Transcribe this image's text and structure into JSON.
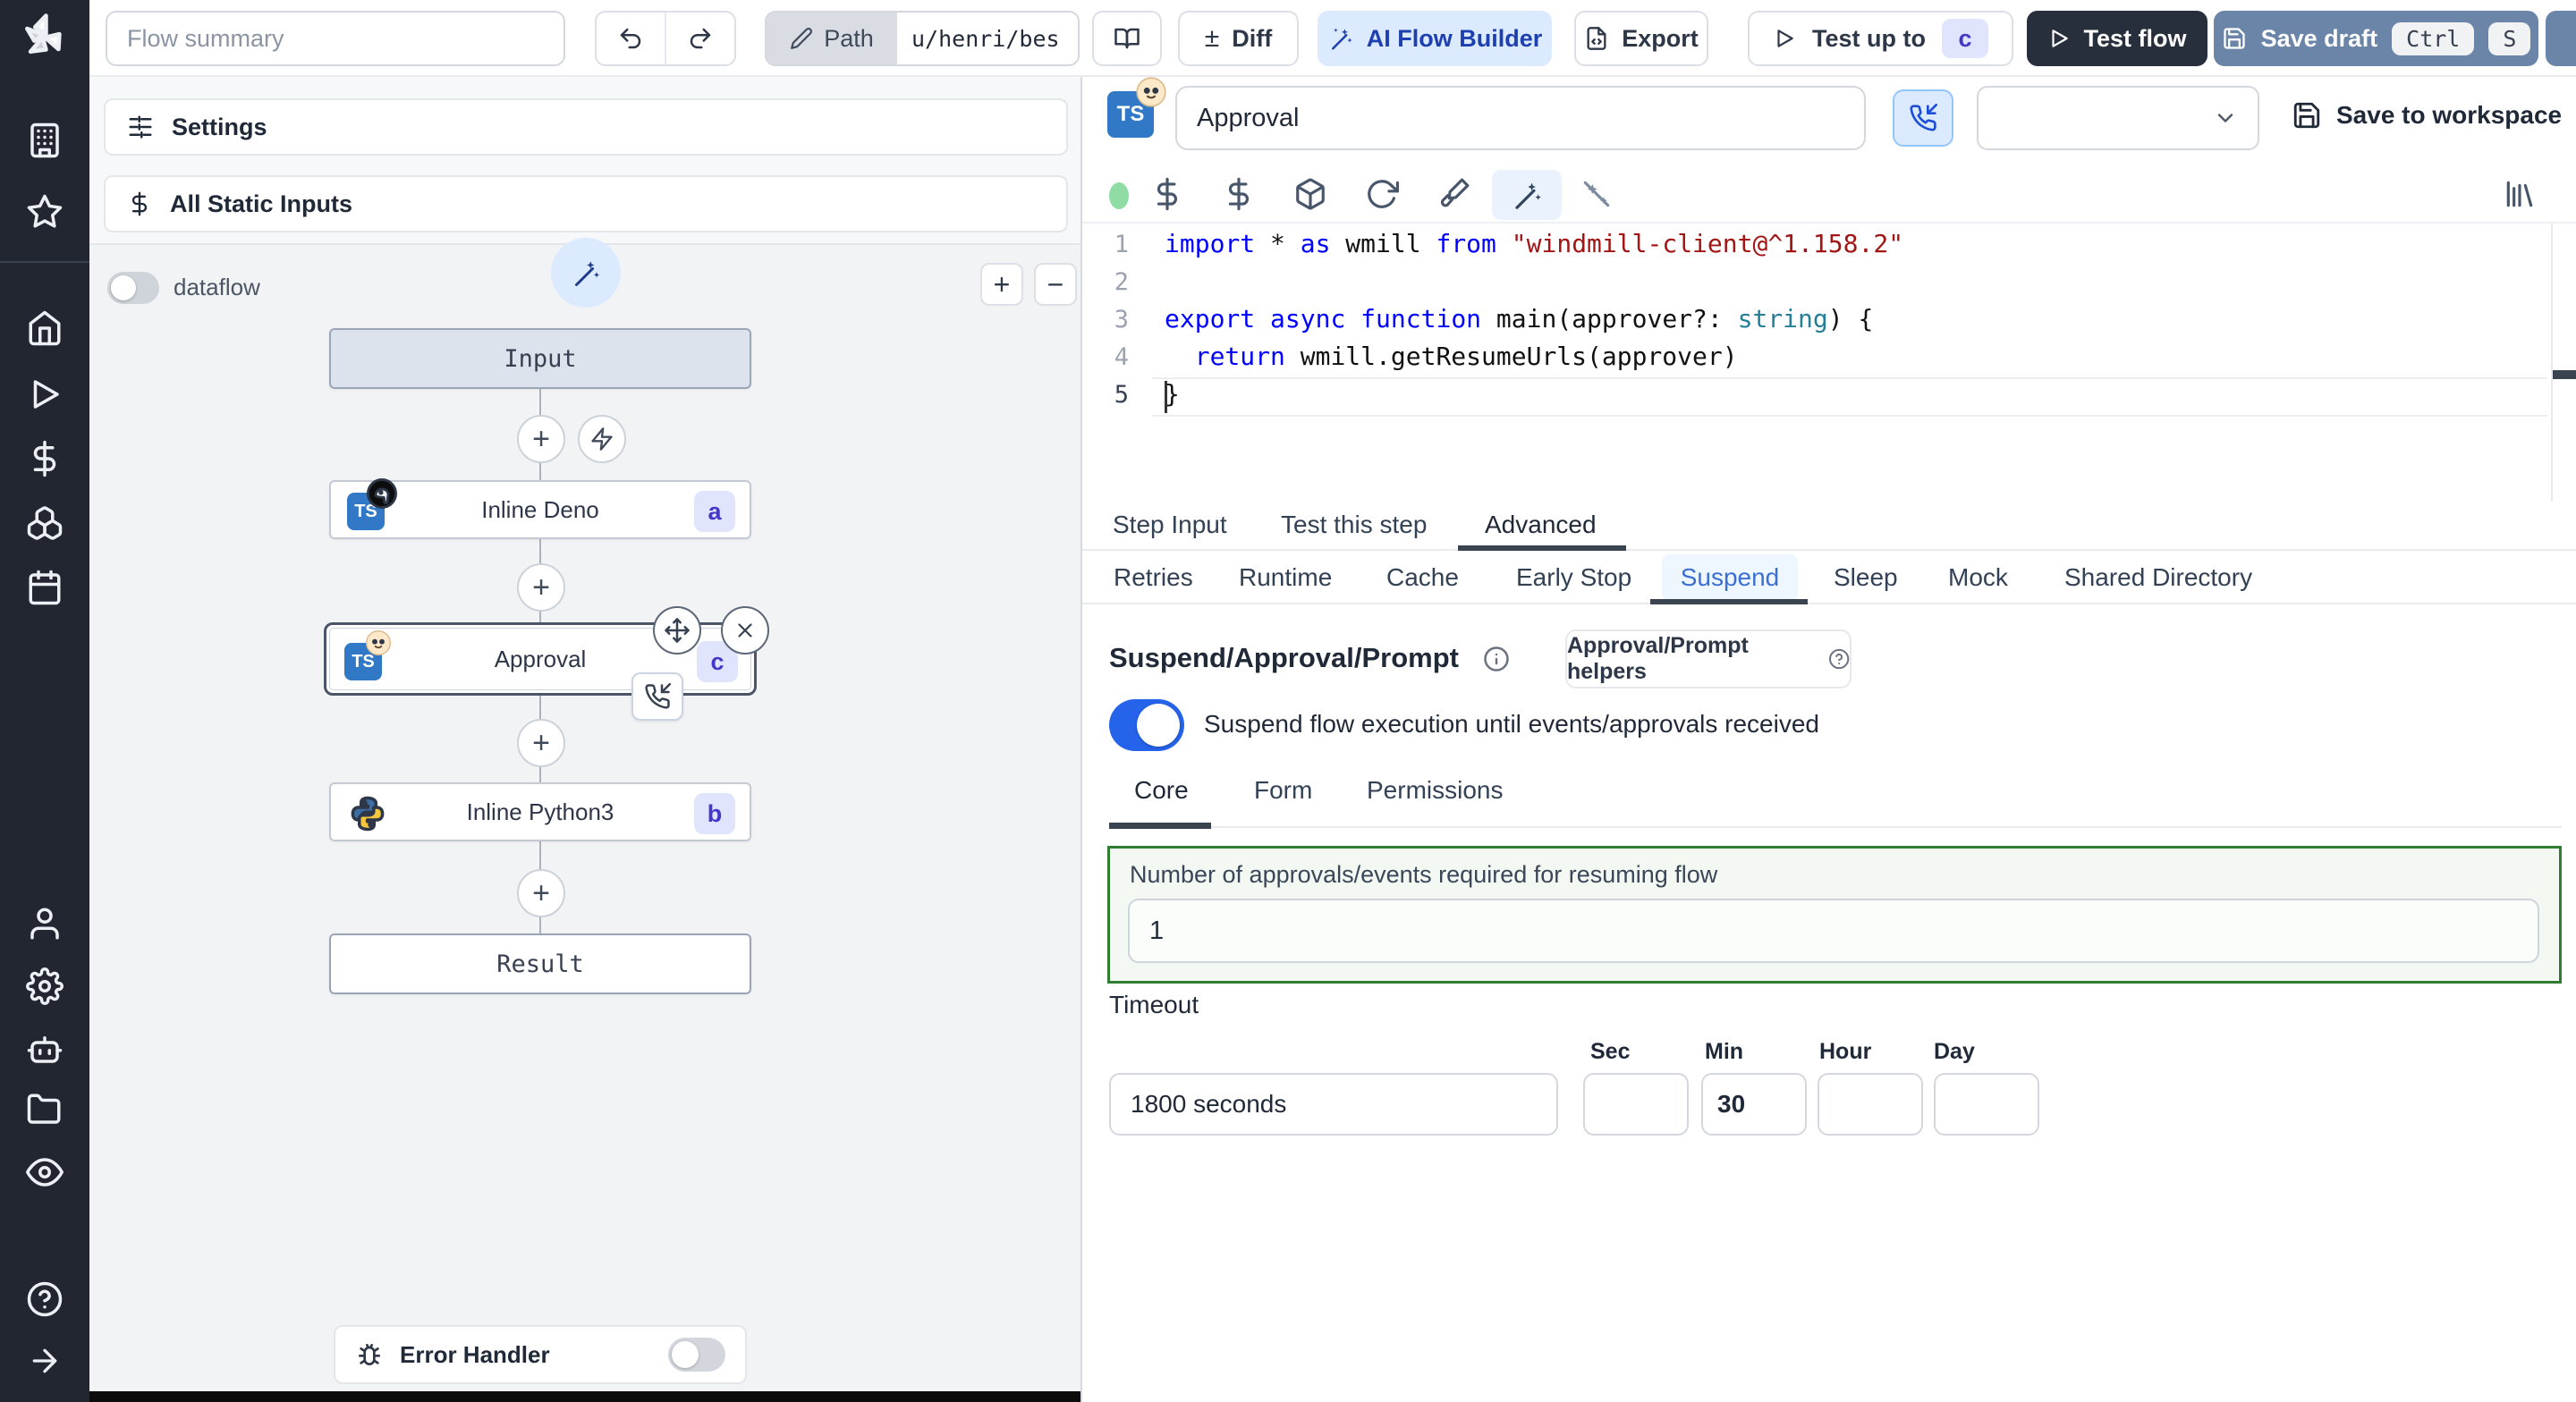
{
  "colors": {
    "sidebar_bg": "#212631",
    "accent_blue": "#2563eb",
    "ai_button_bg": "#dbeafe",
    "ai_button_text": "#1e40af",
    "test_flow_bg": "#262f3b",
    "save_draft_bg": "#6b85a8",
    "badge_bg": "#e0e4fc",
    "badge_text": "#4338ca",
    "ts_badge_bg": "#3178c6",
    "suspend_box_border": "#2e7d32",
    "code_keyword": "#0000ff",
    "code_string": "#a31515",
    "code_type": "#267f99"
  },
  "sidebar": {
    "icons": [
      "windmill-logo",
      "building",
      "star",
      "home",
      "play",
      "dollar",
      "resources",
      "calendar",
      "user",
      "settings",
      "worker",
      "folder",
      "eye",
      "help",
      "expand"
    ]
  },
  "topbar": {
    "flow_summary_placeholder": "Flow summary",
    "path_label": "Path",
    "path_value": "u/henri/bes",
    "diff_label": "Diff",
    "diff_sign": "±",
    "ai_builder_label": "AI Flow Builder",
    "export_label": "Export",
    "test_up_to_label": "Test up to",
    "test_up_to_badge": "c",
    "test_flow_label": "Test flow",
    "save_draft_label": "Save draft",
    "kbd_ctrl": "Ctrl",
    "kbd_s": "S"
  },
  "flow_panel": {
    "settings_label": "Settings",
    "all_static_inputs_label": "All Static Inputs",
    "dataflow_label": "dataflow",
    "zoom_in_label": "+",
    "zoom_out_label": "−",
    "nodes": {
      "input_label": "Input",
      "deno_lang": "TS",
      "deno_label": "Inline Deno",
      "deno_badge": "a",
      "approval_lang": "TS",
      "approval_label": "Approval",
      "approval_badge": "c",
      "python_label": "Inline Python3",
      "python_badge": "b",
      "result_label": "Result"
    },
    "error_handler_label": "Error Handler"
  },
  "step_panel": {
    "lang_badge": "TS",
    "name_value": "Approval",
    "save_to_workspace_label": "Save to workspace",
    "code": {
      "line_numbers": [
        "1",
        "2",
        "3",
        "4",
        "5"
      ],
      "l1": {
        "kw1": "import",
        "p1": " * ",
        "kw2": "as",
        "p2": " wmill ",
        "kw3": "from",
        "str": " \"windmill-client@^1.158.2\""
      },
      "l3": {
        "kw1": "export",
        "p1": " ",
        "kw2": "async",
        "p2": " ",
        "kw3": "function",
        "p3": " main(approver?: ",
        "type": "string",
        "p4": ") {"
      },
      "l4": {
        "ind": "  ",
        "kw1": "return",
        "p1": " wmill.getResumeUrls(approver)"
      },
      "l5": {
        "p1": "}"
      }
    },
    "tabs": {
      "step_input": "Step Input",
      "test_this_step": "Test this step",
      "advanced": "Advanced"
    },
    "advanced_tabs": {
      "retries": "Retries",
      "runtime": "Runtime",
      "cache": "Cache",
      "early_stop": "Early Stop",
      "suspend": "Suspend",
      "sleep": "Sleep",
      "mock": "Mock",
      "shared_directory": "Shared Directory"
    },
    "suspend": {
      "title": "Suspend/Approval/Prompt",
      "helpers_label": "Approval/Prompt helpers",
      "toggle_label": "Suspend flow execution until events/approvals received",
      "tabs": {
        "core": "Core",
        "form": "Form",
        "permissions": "Permissions"
      },
      "approvals_label": "Number of approvals/events required for resuming flow",
      "approvals_value": "1",
      "timeout_label": "Timeout",
      "timeout_value": "1800 seconds",
      "unit_sec": "Sec",
      "unit_min": "Min",
      "unit_hour": "Hour",
      "unit_day": "Day",
      "min_value": "30"
    }
  }
}
